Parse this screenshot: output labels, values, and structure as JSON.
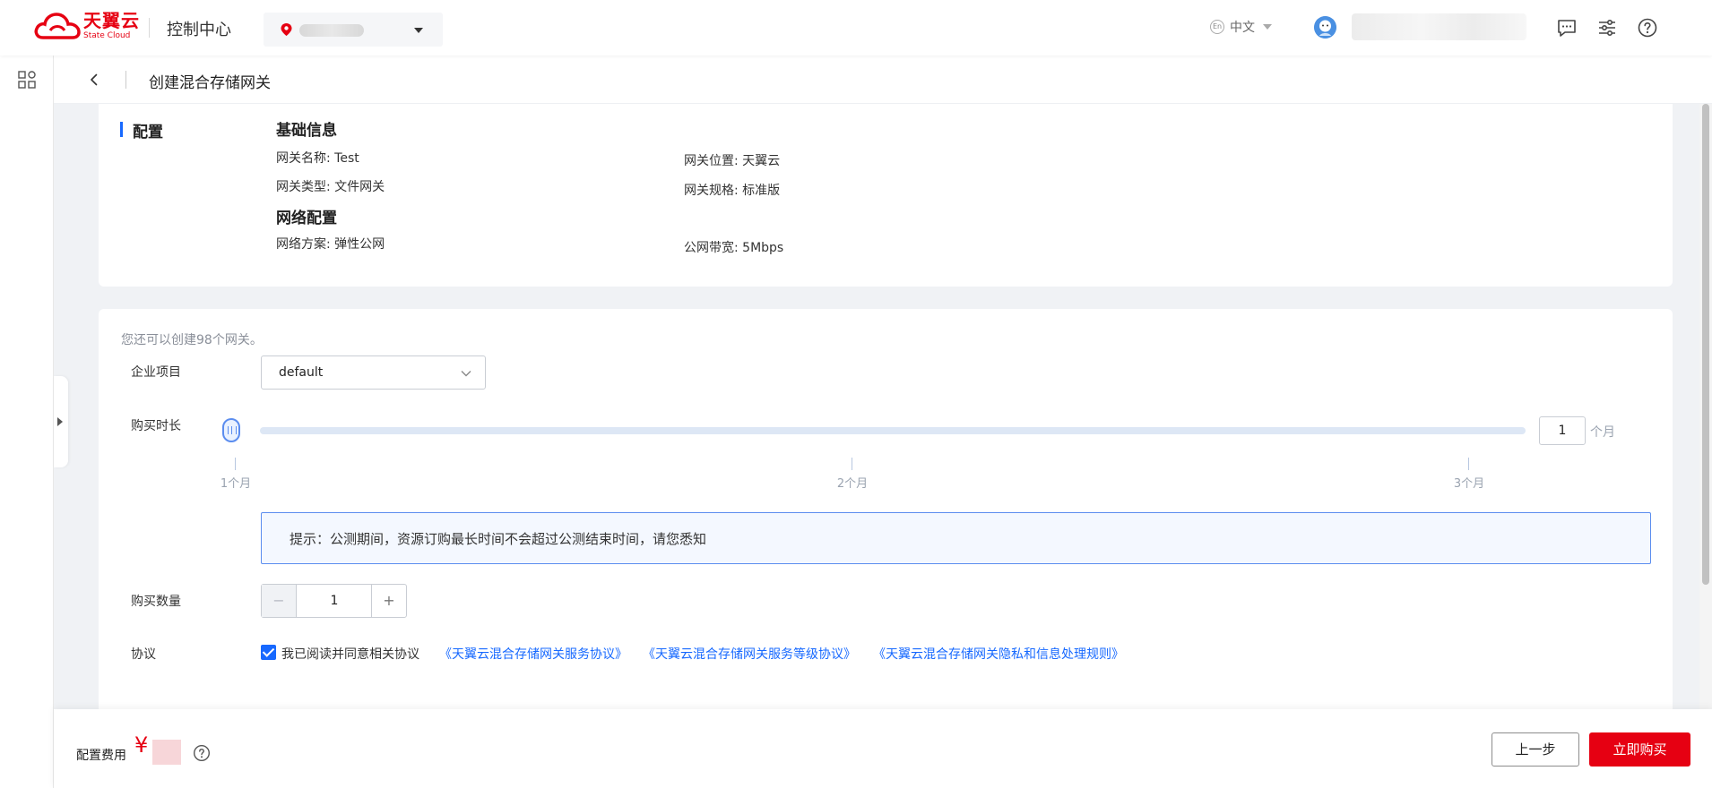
{
  "header": {
    "logo_cn": "天翼云",
    "logo_en": "State Cloud",
    "console_title": "控制中心",
    "language": "中文",
    "language_icon": "En"
  },
  "page": {
    "title": "创建混合存储网关"
  },
  "config": {
    "section_label": "配置",
    "basic_title": "基础信息",
    "gateway_name": "网关名称: Test",
    "gateway_location": "网关位置: 天翼云",
    "gateway_type": "网关类型: 文件网关",
    "gateway_spec": "网关规格: 标准版",
    "network_title": "网络配置",
    "network_plan": "网络方案: 弹性公网",
    "bandwidth": "公网带宽: 5Mbps"
  },
  "form": {
    "quota_hint": "您还可以创建98个网关。",
    "project_label": "企业项目",
    "project_value": "default",
    "duration_label": "购买时长",
    "duration_value": "1",
    "duration_unit": "个月",
    "duration_fraction": 0.0,
    "ticks": [
      {
        "label": "1个月",
        "pos": 0
      },
      {
        "label": "2个月",
        "pos": 0.5
      },
      {
        "label": "3个月",
        "pos": 1
      }
    ],
    "tip": "提示：公测期间，资源订购最长时间不会超过公测结束时间，请您悉知",
    "quantity_label": "购买数量",
    "quantity_value": "1",
    "quantity_minus": "−",
    "quantity_plus": "+",
    "agreement_label": "协议",
    "agreement_text": "我已阅读并同意相关协议",
    "agreement_links": [
      "《天翼云混合存储网关服务协议》",
      "《天翼云混合存储网关服务等级协议》",
      "《天翼云混合存储网关隐私和信息处理规则》"
    ]
  },
  "footer": {
    "fee_label": "配置费用",
    "currency": "¥",
    "prev_button": "上一步",
    "buy_button": "立即购买"
  },
  "colors": {
    "brand_red": "#e60012",
    "accent_blue": "#1769ff"
  }
}
